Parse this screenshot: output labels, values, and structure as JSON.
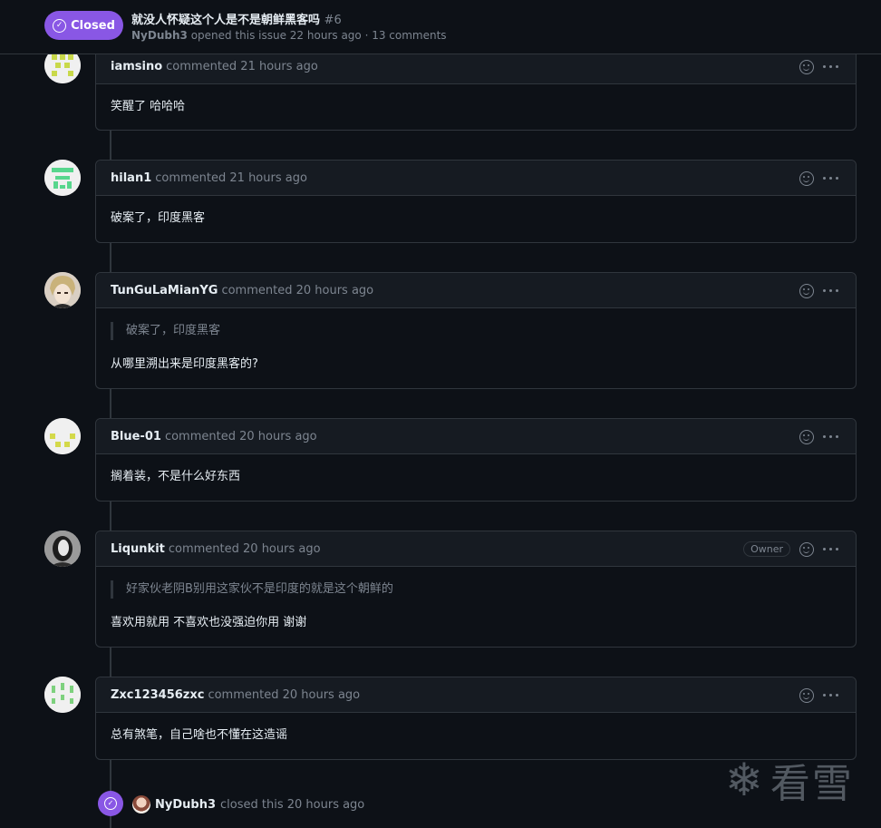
{
  "issue": {
    "state_label": "Closed",
    "title": "就没人怀疑这个人是不是朝鲜黑客吗",
    "number": "#6",
    "author": "NyDubh3",
    "meta_text": "opened this issue 22 hours ago · 13 comments"
  },
  "comments": [
    {
      "author": "iamsino",
      "time": "commented 21 hours ago",
      "quote": "",
      "body": "笑醒了 哈哈哈",
      "owner": ""
    },
    {
      "author": "hilan1",
      "time": "commented 21 hours ago",
      "quote": "",
      "body": "破案了，印度黑客",
      "owner": ""
    },
    {
      "author": "TunGuLaMianYG",
      "time": "commented 20 hours ago",
      "quote": "破案了，印度黑客",
      "body": "从哪里溯出来是印度黑客的?",
      "owner": ""
    },
    {
      "author": "Blue-01",
      "time": "commented 20 hours ago",
      "quote": "",
      "body": "搁着装，不是什么好东西",
      "owner": ""
    },
    {
      "author": "Liqunkit",
      "time": "commented 20 hours ago",
      "quote": "好家伙老阴B别用这家伙不是印度的就是这个朝鲜的",
      "body": "喜欢用就用 不喜欢也没强迫你用 谢谢",
      "owner": "Owner"
    },
    {
      "author": "Zxc123456zxc",
      "time": "commented 20 hours ago",
      "quote": "",
      "body": "总有煞笔，自己啥也不懂在这造谣",
      "owner": ""
    }
  ],
  "close_event": {
    "actor": "NyDubh3",
    "text": "closed this 20 hours ago"
  },
  "watermark": {
    "text": "看雪",
    "icon": "snowflake-icon"
  },
  "colors": {
    "closed_purple": "#8957e5",
    "background": "#0d1117",
    "header_bg": "#161b22",
    "border": "#30363d",
    "muted": "#7d8590"
  }
}
